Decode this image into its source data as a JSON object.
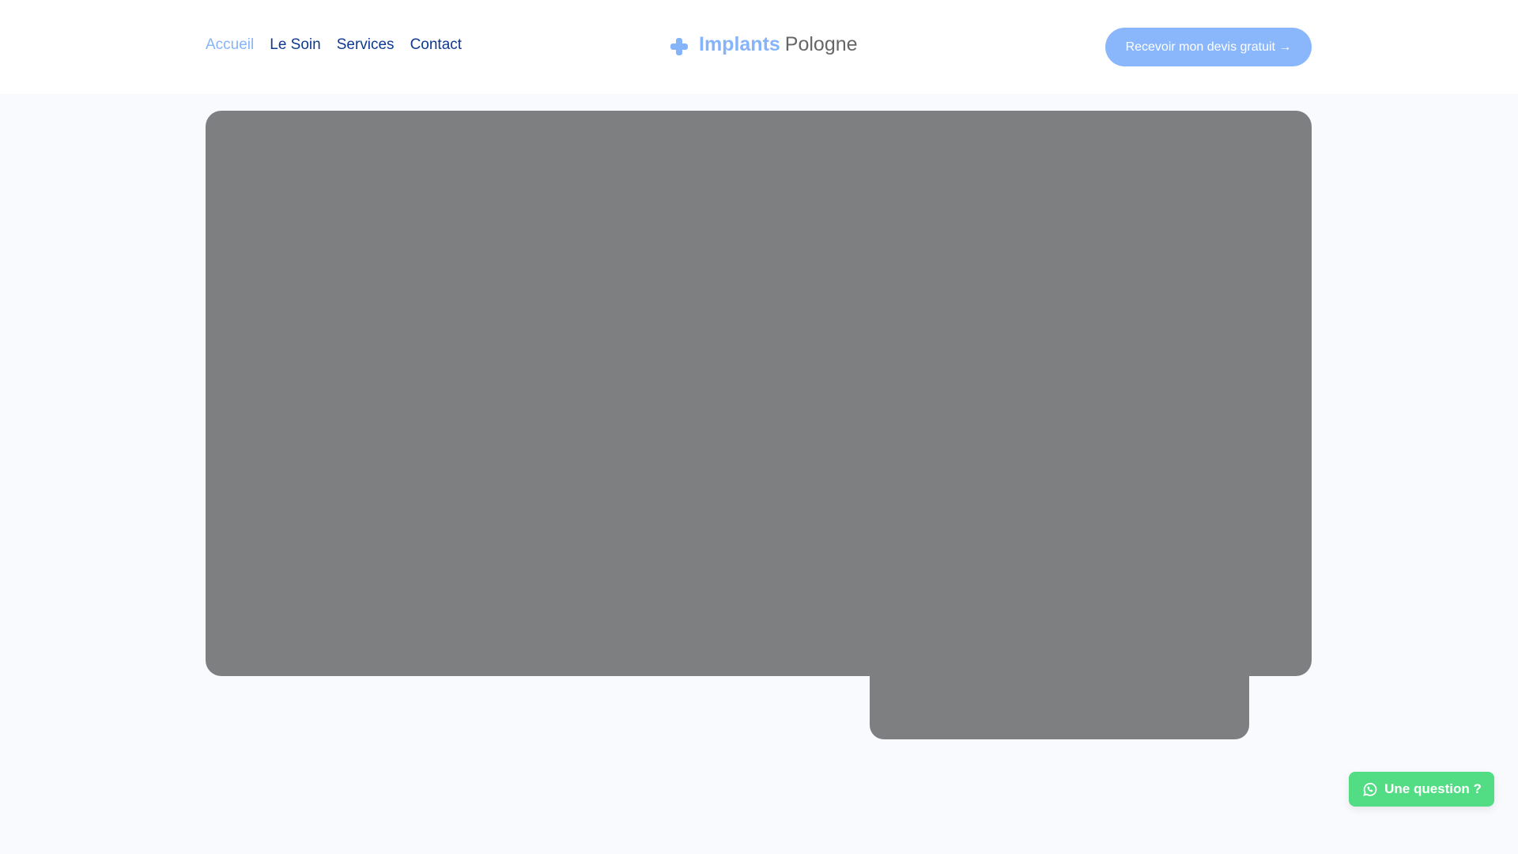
{
  "nav": {
    "items": [
      {
        "label": "Accueil",
        "active": true
      },
      {
        "label": "Le Soin"
      },
      {
        "label": "Services"
      },
      {
        "label": "Contact"
      }
    ]
  },
  "logo": {
    "bold": "Implants",
    "rest": "Pologne",
    "icon": "plus-icon"
  },
  "cta": {
    "label": "Recevoir mon devis gratuit →"
  },
  "whatsapp": {
    "label": "Une question ?",
    "icon": "whatsapp-icon",
    "color": "#52dc83"
  },
  "colors": {
    "accent": "#86b4fb",
    "nav": "#0f3a8f",
    "placeholder": "#7e7f81"
  }
}
